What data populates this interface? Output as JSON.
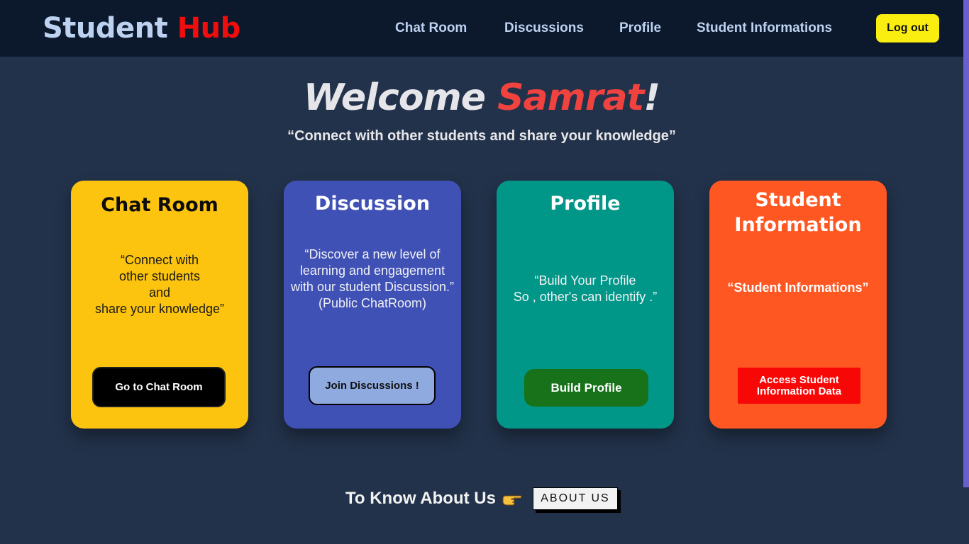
{
  "header": {
    "logo_main": "Student",
    "logo_accent": "Hub",
    "nav": [
      "Chat Room",
      "Discussions",
      "Profile",
      "Student Informations"
    ],
    "logout_label": "Log out"
  },
  "hero": {
    "welcome": "Welcome",
    "user_name": "Samrat",
    "exclaim": "!",
    "tagline": "“Connect with other students and share your knowledge”"
  },
  "cards": [
    {
      "title": "Chat Room",
      "description": "“Connect with\nother students\nand\nshare your knowledge”",
      "button": "Go to Chat Room",
      "color": "#fcc40f"
    },
    {
      "title": "Discussion",
      "description": "“Discover a new level of\nlearning and engagement\nwith our student Discussion.”\n(Public ChatRoom)",
      "button": "Join Discussions !",
      "color": "#3f51b5"
    },
    {
      "title": "Profile",
      "description": "“Build Your Profile\nSo , other's can identify .”",
      "button": "Build Profile",
      "color": "#009688"
    },
    {
      "title": "Student\nInformation",
      "description": "“Student Informations”",
      "button": "Access Student\nInformation Data",
      "color": "#ff5722"
    }
  ],
  "footer": {
    "about_text": "To Know About Us",
    "about_icon": "pointing-hand-icon",
    "about_button": "ABOUT US"
  }
}
